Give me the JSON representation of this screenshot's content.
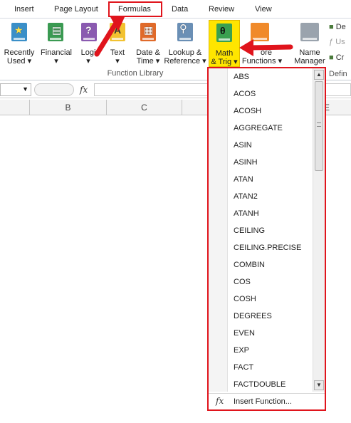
{
  "tabs": [
    "Insert",
    "Page Layout",
    "Formulas",
    "Data",
    "Review",
    "View"
  ],
  "active_tab": "Formulas",
  "ribbon": {
    "buttons": [
      {
        "line1": "Recently",
        "line2": "Used ▾"
      },
      {
        "line1": "Financial",
        "line2": "▾"
      },
      {
        "line1": "Logi",
        "line2": "▾"
      },
      {
        "line1": "Text",
        "line2": "▾"
      },
      {
        "line1": "Date &",
        "line2": "Time ▾"
      },
      {
        "line1": "Lookup &",
        "line2": "Reference ▾"
      },
      {
        "line1": "Math",
        "line2": "& Trig ▾"
      },
      {
        "line1": "ore",
        "line2": "Functions ▾"
      },
      {
        "line1": "Name",
        "line2": "Manager"
      }
    ],
    "group_label": "Function Library",
    "defined_names_partial": [
      "De",
      "Us",
      "Cr"
    ],
    "defined_group_partial": "Defin"
  },
  "formula_bar": {
    "fx": "fx",
    "value": ""
  },
  "columns": [
    "B",
    "C",
    "E"
  ],
  "dropdown": {
    "items": [
      "ABS",
      "ACOS",
      "ACOSH",
      "AGGREGATE",
      "ASIN",
      "ASINH",
      "ATAN",
      "ATAN2",
      "ATANH",
      "CEILING",
      "CEILING.PRECISE",
      "COMBIN",
      "COS",
      "COSH",
      "DEGREES",
      "EVEN",
      "EXP",
      "FACT",
      "FACTDOUBLE"
    ],
    "insert_function_label": "Insert Function...",
    "scroll_up": "▲",
    "scroll_down": "▼"
  },
  "colors": {
    "highlight": "#e0141c",
    "math_button_bg": "#ffe500"
  }
}
